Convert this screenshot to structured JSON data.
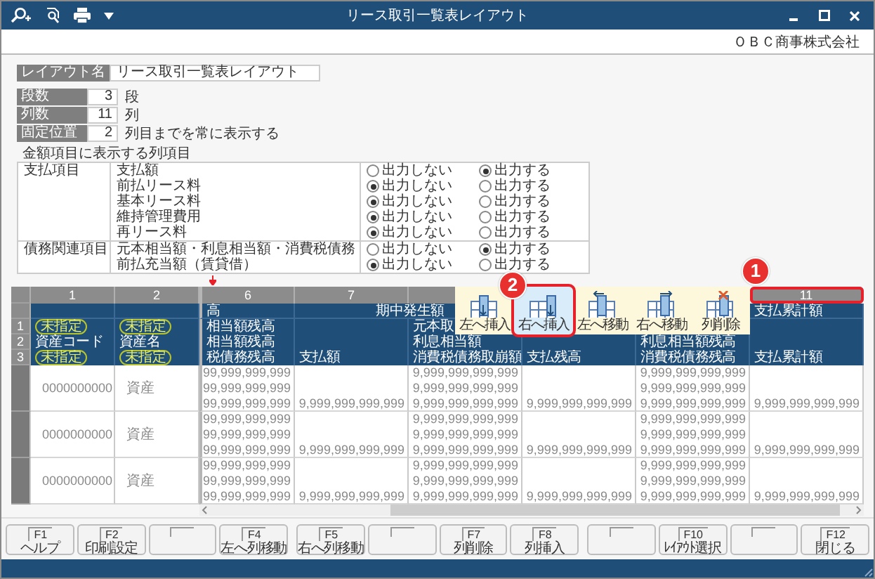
{
  "window": {
    "title": "リース取引一覧表レイアウト",
    "company": "ＯＢＣ商事株式会社"
  },
  "layout_name": {
    "label": "レイアウト名",
    "value": "リース取引一覧表レイアウト"
  },
  "settings": [
    {
      "label": "段数",
      "value": "3",
      "unit": "段"
    },
    {
      "label": "列数",
      "value": "11",
      "unit": "列"
    },
    {
      "label": "固定位置",
      "value": "2",
      "unit": "列目までを常に表示する"
    }
  ],
  "amount_items": {
    "caption": "金額項目に表示する列項目",
    "groups": [
      {
        "name": "支払項目",
        "items": [
          {
            "label": "支払額",
            "options": [
              {
                "label": "出力しない",
                "selected": false
              },
              {
                "label": "出力する",
                "selected": true
              }
            ]
          },
          {
            "label": "前払リース料",
            "options": [
              {
                "label": "出力しない",
                "selected": true
              },
              {
                "label": "出力する",
                "selected": false
              }
            ]
          },
          {
            "label": "基本リース料",
            "options": [
              {
                "label": "出力しない",
                "selected": true
              },
              {
                "label": "出力する",
                "selected": false
              }
            ]
          },
          {
            "label": "維持管理費用",
            "options": [
              {
                "label": "出力しない",
                "selected": true
              },
              {
                "label": "出力する",
                "selected": false
              }
            ]
          },
          {
            "label": "再リース料",
            "options": [
              {
                "label": "出力しない",
                "selected": true
              },
              {
                "label": "出力する",
                "selected": false
              }
            ]
          }
        ]
      },
      {
        "name": "債務関連項目",
        "items": [
          {
            "label": "元本相当額・利息相当額・消費税債務",
            "options": [
              {
                "label": "出力しない",
                "selected": false
              },
              {
                "label": "出力する",
                "selected": true
              }
            ]
          },
          {
            "label": "前払充当額（賃貸借）",
            "options": [
              {
                "label": "出力しない",
                "selected": true
              },
              {
                "label": "出力する",
                "selected": false
              }
            ]
          }
        ]
      }
    ]
  },
  "grid": {
    "row_numbers": [
      "1",
      "2",
      "3"
    ],
    "columns": [
      {
        "number": "1",
        "heads": [
          {
            "kind": "badge",
            "text": "未指定"
          },
          {
            "kind": "text",
            "text": "資産コード"
          },
          {
            "kind": "badge",
            "text": "未指定"
          }
        ]
      },
      {
        "number": "2",
        "heads": [
          {
            "kind": "badge",
            "text": "未指定"
          },
          {
            "kind": "text",
            "text": "資産名"
          },
          {
            "kind": "badge",
            "text": "未指定"
          }
        ]
      },
      {
        "number": "6",
        "group": "高",
        "heads": [
          {
            "kind": "text",
            "text": "相当額残高"
          },
          {
            "kind": "text",
            "text": "相当額残高"
          },
          {
            "kind": "text",
            "text": "税債務残高"
          }
        ]
      },
      {
        "number": "7",
        "group": "期中発生額",
        "group_wide": true,
        "heads": [
          {
            "kind": "blank"
          },
          {
            "kind": "blank"
          },
          {
            "kind": "text",
            "text": "支払額"
          }
        ]
      },
      {
        "heads": [
          {
            "kind": "text",
            "text": "元本取"
          },
          {
            "kind": "text",
            "text": "利息相当額"
          },
          {
            "kind": "text",
            "text": "消費税債務取崩額"
          }
        ]
      },
      {
        "heads": [
          {
            "kind": "blank"
          },
          {
            "kind": "blank"
          },
          {
            "kind": "text",
            "text": "支払残高"
          }
        ]
      },
      {
        "heads": [
          {
            "kind": "blank"
          },
          {
            "kind": "text",
            "text": "利息相当額残高"
          },
          {
            "kind": "text",
            "text": "消費税債務残高"
          }
        ]
      },
      {
        "number": "11",
        "group": "支払累計額",
        "highlighted": true,
        "callout": "1",
        "heads": [
          {
            "kind": "blank"
          },
          {
            "kind": "blank"
          },
          {
            "kind": "text",
            "text": "支払累計額"
          }
        ]
      }
    ],
    "rows": [
      {
        "cells": [
          "0000000000",
          "資産",
          [
            "99,999,999,999",
            "99,999,999,999",
            "99,999,999,999"
          ],
          [
            null,
            null,
            "9,999,999,999,999"
          ],
          [
            "9,999,999,999,999",
            "9,999,999,999,999",
            "9,999,999,999,999"
          ],
          [
            null,
            null,
            "9,999,999,999,999"
          ],
          [
            "9,999,999,999,999",
            "9,999,999,999,999",
            "9,999,999,999,999"
          ],
          [
            null,
            null,
            "9,999,999,999,999"
          ]
        ]
      },
      {
        "cells": [
          "0000000000",
          "資産",
          [
            "99,999,999,999",
            "99,999,999,999",
            "99,999,999,999"
          ],
          [
            null,
            null,
            "9,999,999,999,999"
          ],
          [
            "9,999,999,999,999",
            "9,999,999,999,999",
            "9,999,999,999,999"
          ],
          [
            null,
            null,
            "9,999,999,999,999"
          ],
          [
            "9,999,999,999,999",
            "9,999,999,999,999",
            "9,999,999,999,999"
          ],
          [
            null,
            null,
            "9,999,999,999,999"
          ]
        ]
      },
      {
        "cells": [
          "0000000000",
          "資産",
          [
            "99,999,999,999",
            "99,999,999,999",
            "99,999,999,999"
          ],
          [
            null,
            null,
            "9,999,999,999,999"
          ],
          [
            "9,999,999,999,999",
            "9,999,999,999,999",
            "9,999,999,999,999"
          ],
          [
            null,
            null,
            "9,999,999,999,999"
          ],
          [
            "9,999,999,999,999",
            "9,999,999,999,999",
            "9,999,999,999,999"
          ],
          [
            null,
            null,
            "9,999,999,999,999"
          ]
        ]
      }
    ]
  },
  "column_menu": {
    "items": [
      {
        "kind": "insertleft",
        "label": "左へ挿入",
        "selected": false
      },
      {
        "kind": "insertright",
        "label": "右へ挿入",
        "selected": true,
        "callout": "2"
      },
      {
        "kind": "moveleft",
        "label": "左へ移動",
        "selected": false
      },
      {
        "kind": "moveright",
        "label": "右へ移動",
        "selected": false
      },
      {
        "kind": "delete",
        "label": "列削除",
        "selected": false
      }
    ]
  },
  "function_keys": [
    {
      "kind": "key",
      "key": "F1",
      "label": "ヘルプ"
    },
    {
      "kind": "key",
      "key": "F2",
      "label": "印刷設定"
    },
    {
      "kind": "blank"
    },
    {
      "kind": "key",
      "key": "F4",
      "label": "左へ列移動"
    },
    {
      "kind": "key",
      "key": "F5",
      "label": "右へ列移動"
    },
    {
      "kind": "blank"
    },
    {
      "kind": "key",
      "key": "F7",
      "label": "列削除"
    },
    {
      "kind": "key",
      "key": "F8",
      "label": "列挿入"
    },
    {
      "kind": "blank"
    },
    {
      "kind": "key",
      "key": "F10",
      "label": "ﾚｲｱｳﾄ選択"
    },
    {
      "kind": "blank"
    },
    {
      "kind": "key",
      "key": "F12",
      "label": "閉じる"
    }
  ]
}
